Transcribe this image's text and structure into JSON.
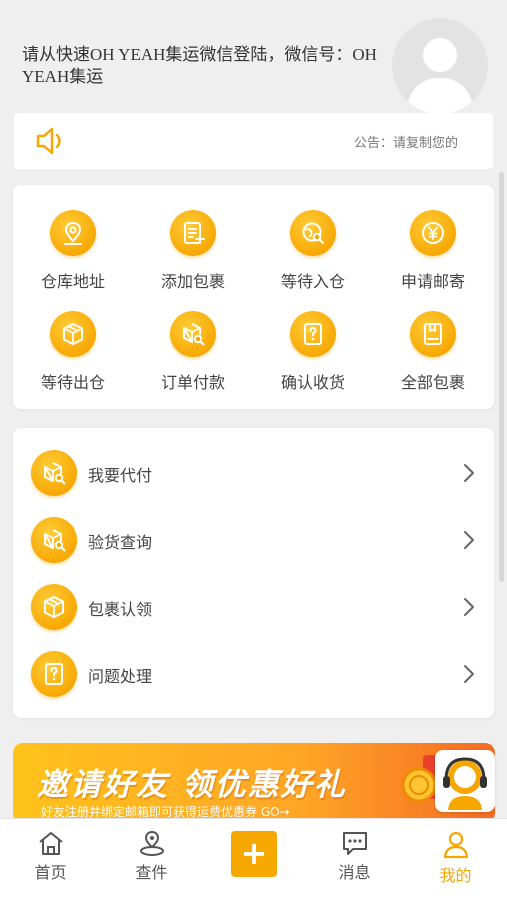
{
  "header": {
    "login_tip": "请从快速OH YEAH集运微信登陆，微信号：OH YEAH集运"
  },
  "notice": {
    "text": "公告：请复制您的"
  },
  "grid": {
    "items": [
      {
        "label": "仓库地址",
        "icon": "location-pin-icon"
      },
      {
        "label": "添加包裹",
        "icon": "add-note-icon"
      },
      {
        "label": "等待入仓",
        "icon": "globe-search-icon"
      },
      {
        "label": "申请邮寄",
        "icon": "yen-coin-icon"
      },
      {
        "label": "等待出仓",
        "icon": "box-icon"
      },
      {
        "label": "订单付款",
        "icon": "box-search-icon"
      },
      {
        "label": "确认收货",
        "icon": "question-doc-icon"
      },
      {
        "label": "全部包裹",
        "icon": "book-icon"
      }
    ]
  },
  "services": {
    "items": [
      {
        "label": "我要代付",
        "icon": "box-search-icon"
      },
      {
        "label": "验货查询",
        "icon": "box-search-icon"
      },
      {
        "label": "包裹认领",
        "icon": "box-icon"
      },
      {
        "label": "问题处理",
        "icon": "question-doc-icon"
      }
    ]
  },
  "banner": {
    "title": "邀请好友 领优惠好礼",
    "subtitle": "好友注册并绑定邮箱即可获得运费优惠券 GO→"
  },
  "tabbar": {
    "tabs": [
      {
        "label": "首页",
        "icon": "home-icon"
      },
      {
        "label": "查件",
        "icon": "track-icon"
      },
      {
        "label": "",
        "icon": "plus-icon"
      },
      {
        "label": "消息",
        "icon": "message-icon"
      },
      {
        "label": "我的",
        "icon": "user-icon"
      }
    ],
    "active_index": 4
  },
  "colors": {
    "accent": "#f7a600",
    "background": "#efefef"
  }
}
